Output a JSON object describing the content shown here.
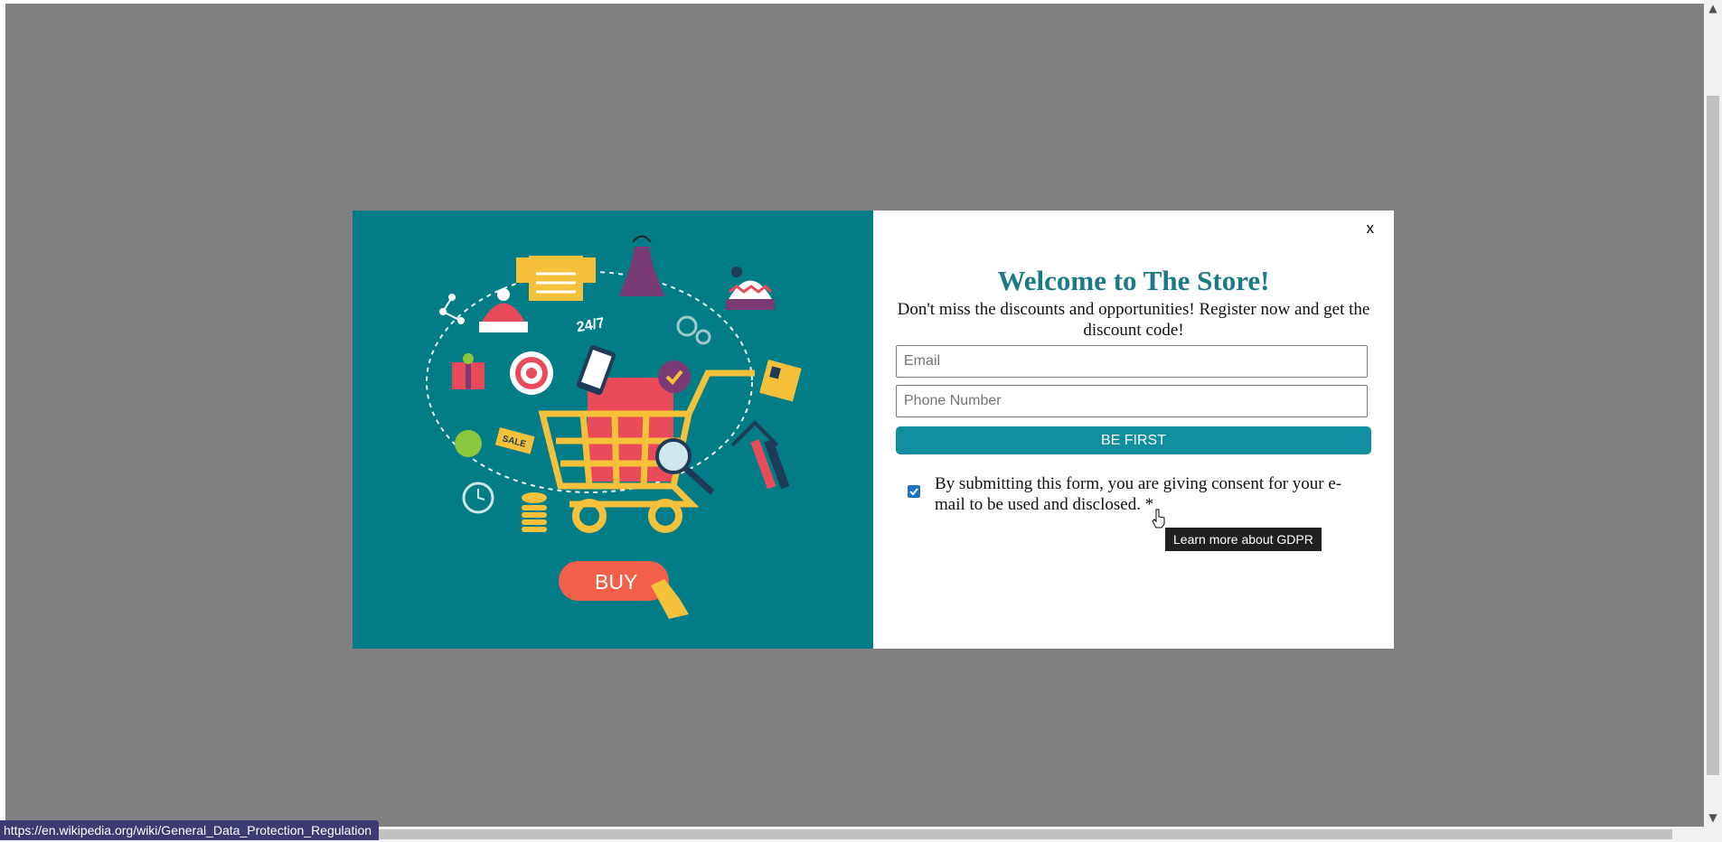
{
  "modal": {
    "close_label": "x",
    "title": "Welcome to The Store!",
    "subtitle": "Don't miss the discounts and opportunities! Register now and get the discount code!",
    "email_placeholder": "Email",
    "phone_placeholder": "Phone Number",
    "submit_label": "BE FIRST",
    "consent_text": "By submitting this form, you are giving consent for your e-mail to be used and disclosed. *",
    "consent_checked": true,
    "image": {
      "buy_label": "BUY",
      "sale_label": "SALE",
      "hours_label": "24/7",
      "background_color": "#027d87"
    }
  },
  "tooltip": "Learn more about GDPR",
  "status_url": "https://en.wikipedia.org/wiki/General_Data_Protection_Regulation",
  "colors": {
    "overlay": "#808080",
    "title": "#1b7a85",
    "button": "#0f8fa0"
  }
}
